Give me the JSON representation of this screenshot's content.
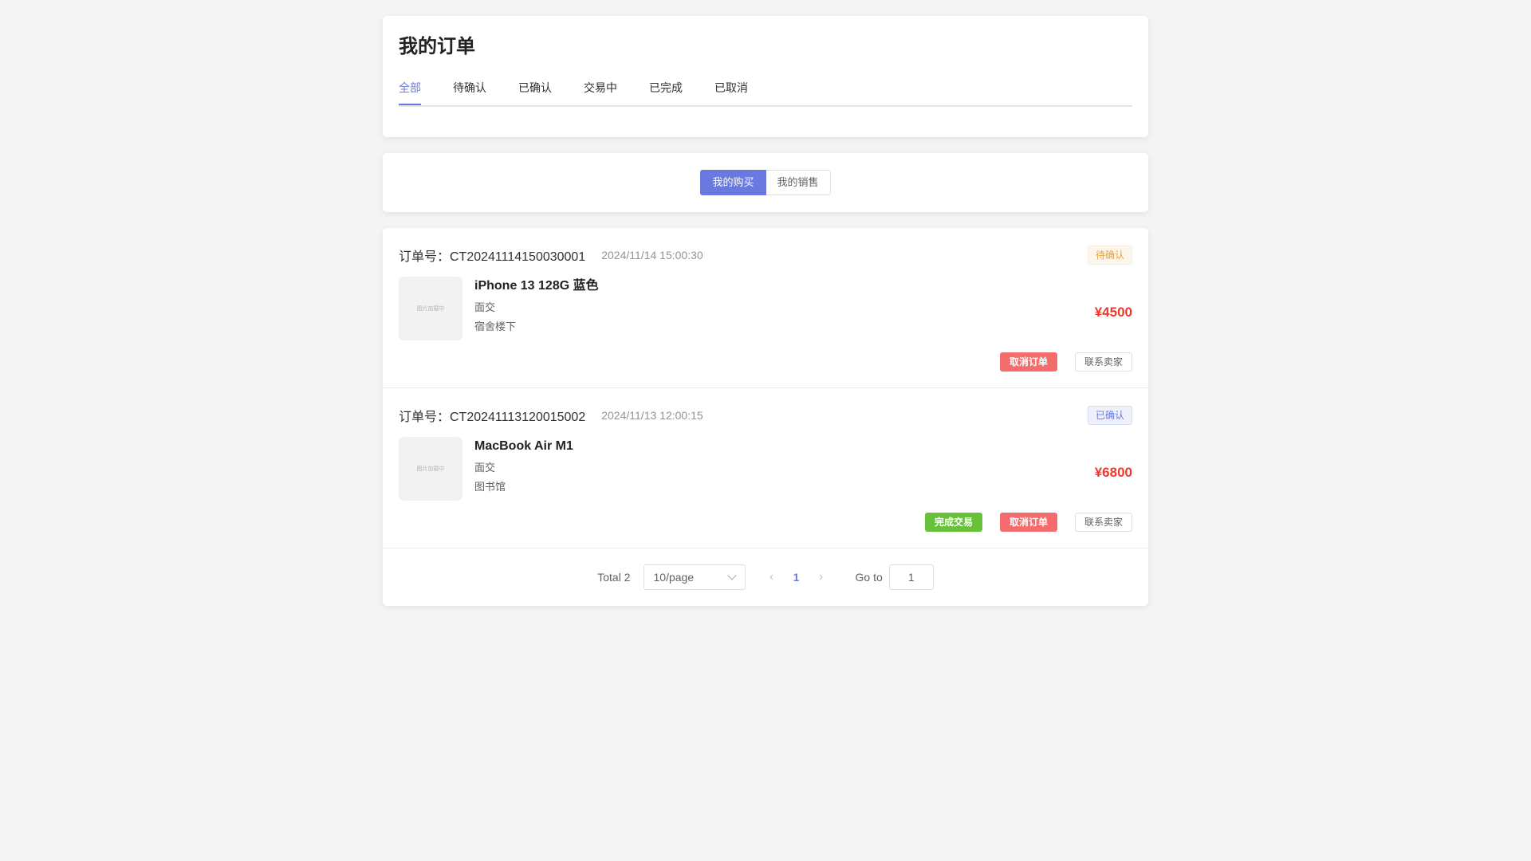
{
  "page": {
    "title": "我的订单"
  },
  "tabs": [
    {
      "label": "全部",
      "active": true
    },
    {
      "label": "待确认"
    },
    {
      "label": "已确认"
    },
    {
      "label": "交易中"
    },
    {
      "label": "已完成"
    },
    {
      "label": "已取消"
    }
  ],
  "switcher": {
    "buy_label": "我的购买",
    "sell_label": "我的销售",
    "active": "buy"
  },
  "thumb_placeholder": "图片加载中",
  "orders": [
    {
      "order_no": "订单号：CT20241114150030001",
      "time": "2024/11/14 15:00:30",
      "status": "待确认",
      "product_name": "iPhone 13 128G 蓝色",
      "trade_method": "面交",
      "location": "宿舍楼下",
      "price": "¥4500",
      "actions": [
        "取消订单",
        "联系卖家"
      ]
    },
    {
      "order_no": "订单号：CT20241113120015002",
      "time": "2024/11/13 12:00:15",
      "status": "已确认",
      "product_name": "MacBook Air M1",
      "trade_method": "面交",
      "location": "图书馆",
      "price": "¥6800",
      "actions": [
        "完成交易",
        "取消订单",
        "联系卖家"
      ]
    }
  ],
  "pagination": {
    "total": "Total 2",
    "page_size": "10/page",
    "current_page": "1",
    "goto_label": "Go to",
    "goto_value": "1"
  },
  "colors": {
    "accent": "#6a79e0",
    "price": "#f0372a",
    "danger": "#f56c6c",
    "success": "#67c23a",
    "warning": "#e6a23c"
  }
}
